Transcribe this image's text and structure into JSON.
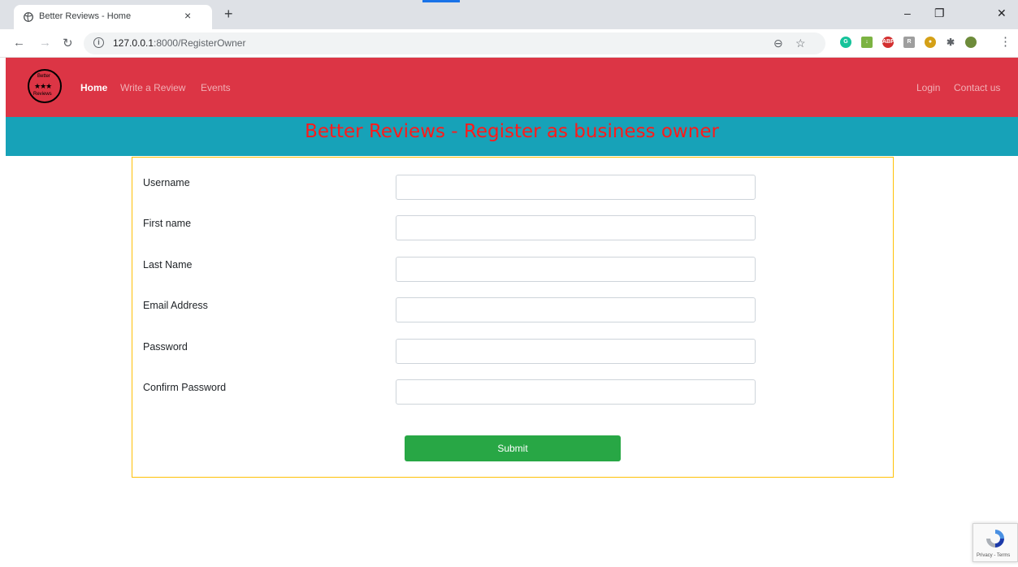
{
  "browser": {
    "tab_title": "Better Reviews - Home",
    "tab_close": "×",
    "new_tab": "+",
    "url_host": "127.0.0.1",
    "url_rest": ":8000/RegisterOwner",
    "minimize": "–",
    "restore": "❐",
    "close": "✕"
  },
  "navbar": {
    "logo_top": "Better",
    "logo_stars": "★★★",
    "logo_bottom": "Reviews",
    "links": [
      "Home",
      "Write a Review",
      "Events"
    ],
    "right_links": [
      "Login",
      "Contact us"
    ],
    "color": "#dc3545"
  },
  "banner": {
    "title": "Better Reviews - Register as business owner",
    "color": "#17a2b8",
    "title_color": "#ff1a1a"
  },
  "form": {
    "fields": [
      {
        "label": "Username",
        "value": ""
      },
      {
        "label": "First name",
        "value": ""
      },
      {
        "label": "Last Name",
        "value": ""
      },
      {
        "label": "Email Address",
        "value": ""
      },
      {
        "label": "Password",
        "value": ""
      },
      {
        "label": "Confirm Password",
        "value": ""
      }
    ],
    "submit_label": "Submit",
    "submit_color": "#28a745",
    "border_color": "#ffc107"
  },
  "recaptcha": {
    "text": "Privacy - Terms"
  }
}
